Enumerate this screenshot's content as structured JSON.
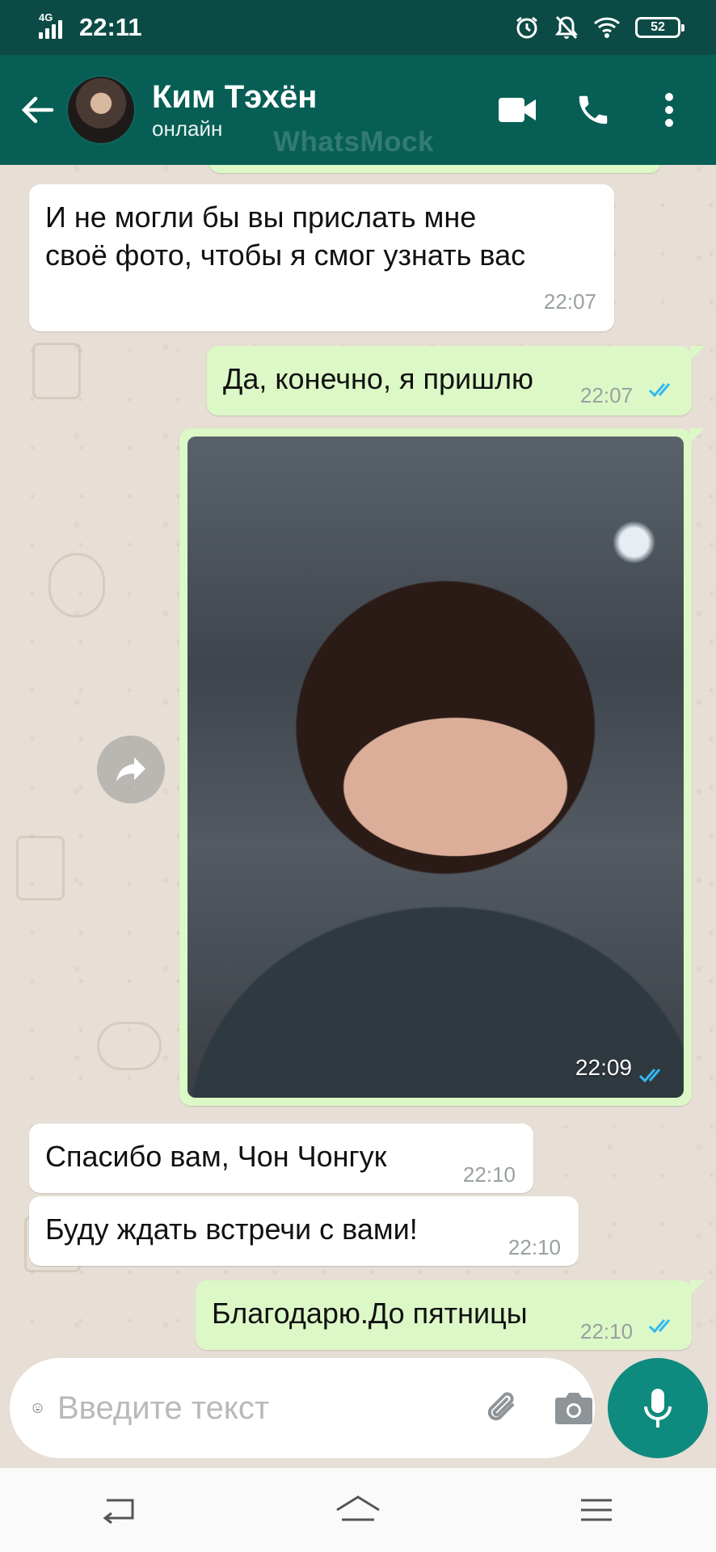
{
  "status_bar": {
    "network": "4G",
    "time": "22:11",
    "battery": "52",
    "icons": [
      "signal-icon",
      "alarm-icon",
      "notifications-off-icon",
      "wifi-icon",
      "battery-icon"
    ]
  },
  "header": {
    "contact_name": "Ким Тэхён",
    "contact_status": "онлайн",
    "watermark": "WhatsMock",
    "icons": [
      "back-arrow-icon",
      "video-call-icon",
      "phone-icon",
      "more-vertical-icon"
    ]
  },
  "messages": [
    {
      "direction": "incoming",
      "lines": [
        "И не могли бы вы прислать мне",
        "своё фото, чтобы я смог узнать вас"
      ],
      "time": "22:07"
    },
    {
      "direction": "outgoing",
      "text": "Да, конечно, я пришлю",
      "time": "22:07",
      "status": "read"
    },
    {
      "direction": "outgoing",
      "type": "photo",
      "time": "22:09",
      "status": "read"
    },
    {
      "direction": "incoming",
      "text": "Спасибо вам, Чон Чонгук",
      "time": "22:10"
    },
    {
      "direction": "incoming",
      "text": "Буду ждать встречи с вами!",
      "time": "22:10"
    },
    {
      "direction": "outgoing",
      "text": "Благодарю.До пятницы",
      "time": "22:10",
      "status": "read"
    }
  ],
  "composer": {
    "placeholder": "Введите текст",
    "value": "",
    "icons": [
      "emoji-icon",
      "attach-icon",
      "camera-icon",
      "mic-icon"
    ]
  },
  "nav_bar": {
    "icons": [
      "back-nav-icon",
      "home-nav-icon",
      "menu-nav-icon"
    ]
  },
  "colors": {
    "status_bar": "#0b4a45",
    "header": "#075e54",
    "chat_background": "#e7ded5",
    "outgoing_bubble": "#dcf8c6",
    "incoming_bubble": "#ffffff",
    "read_ticks": "#34b7f1",
    "mic_button": "#0f8a7e"
  }
}
